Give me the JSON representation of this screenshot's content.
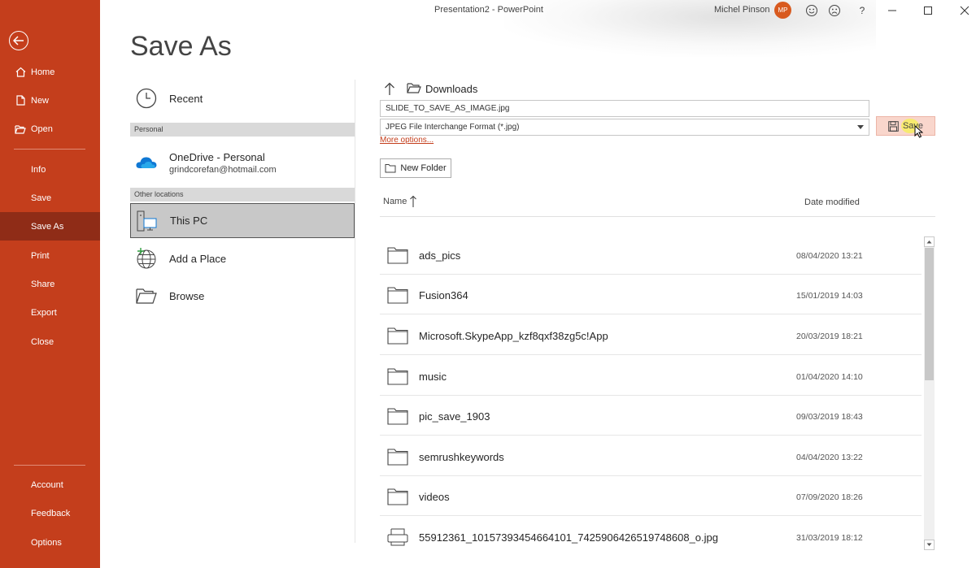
{
  "window": {
    "title": "Presentation2  -  PowerPoint",
    "user_name": "Michel Pinson",
    "user_initials": "MP"
  },
  "nav": {
    "top_items": [
      {
        "label": "Home",
        "icon": "home-icon"
      },
      {
        "label": "New",
        "icon": "new-doc-icon"
      },
      {
        "label": "Open",
        "icon": "open-folder-icon"
      }
    ],
    "mid_items": [
      {
        "label": "Info"
      },
      {
        "label": "Save"
      },
      {
        "label": "Save As",
        "active": true
      },
      {
        "label": "Print"
      },
      {
        "label": "Share"
      },
      {
        "label": "Export"
      },
      {
        "label": "Close"
      }
    ],
    "bottom_items": [
      {
        "label": "Account"
      },
      {
        "label": "Feedback"
      },
      {
        "label": "Options"
      }
    ],
    "accent_color": "#c43e1c",
    "active_color": "#8f2c17"
  },
  "page_title": "Save As",
  "locations": {
    "recent": "Recent",
    "personal_header": "Personal",
    "onedrive": {
      "name": "OneDrive - Personal",
      "account": "grindcorefan@hotmail.com"
    },
    "other_header": "Other locations",
    "this_pc": "This PC",
    "add_place": "Add a Place",
    "browse": "Browse"
  },
  "save_pane": {
    "current_folder": "Downloads",
    "file_name": "SLIDE_TO_SAVE_AS_IMAGE.jpg",
    "file_type": "JPEG File Interchange Format (*.jpg)",
    "more_options": "More options...",
    "save_label": "Save",
    "new_folder_label": "New Folder",
    "col_name": "Name",
    "col_date": "Date modified"
  },
  "files": [
    {
      "name": "ads_pics",
      "date": "08/04/2020 13:21",
      "type": "folder"
    },
    {
      "name": "Fusion364",
      "date": "15/01/2019 14:03",
      "type": "folder"
    },
    {
      "name": "Microsoft.SkypeApp_kzf8qxf38zg5c!App",
      "date": "20/03/2019 18:21",
      "type": "folder"
    },
    {
      "name": "music",
      "date": "01/04/2020 14:10",
      "type": "folder"
    },
    {
      "name": "pic_save_1903",
      "date": "09/03/2019 18:43",
      "type": "folder"
    },
    {
      "name": "semrushkeywords",
      "date": "04/04/2020 13:22",
      "type": "folder"
    },
    {
      "name": "videos",
      "date": "07/09/2020 18:26",
      "type": "folder"
    },
    {
      "name": "55912361_10157393454664101_7425906426519748608_o.jpg",
      "date": "31/03/2019 18:12",
      "type": "image-file"
    }
  ]
}
